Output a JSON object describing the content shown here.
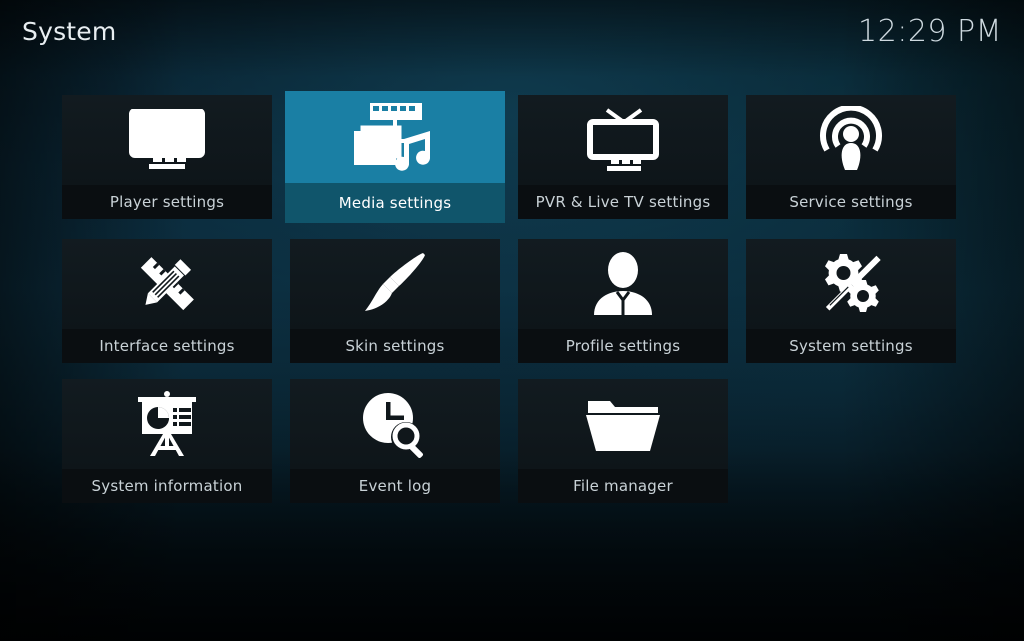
{
  "header": {
    "title": "System",
    "clock": "12:29 PM"
  },
  "colors": {
    "accent": "#1a7fa4",
    "accent_label": "#10556b",
    "tile_bg": "#10171b",
    "tile_label_bg": "#0a0e11",
    "text": "#c9d2d7",
    "icon": "#ffffff",
    "background_top": "#0c2d3f",
    "background_bottom": "#01070b"
  },
  "grid": {
    "rows": [
      [
        {
          "id": "player-settings",
          "label": "Player settings",
          "icon": "monitor-play-icon",
          "selected": false
        },
        {
          "id": "media-settings",
          "label": "Media settings",
          "icon": "media-filmstrip-photo-music-icon",
          "selected": true
        },
        {
          "id": "pvr-live-tv",
          "label": "PVR & Live TV settings",
          "icon": "television-antenna-icon",
          "selected": false
        },
        {
          "id": "service-settings",
          "label": "Service settings",
          "icon": "broadcast-person-icon",
          "selected": false
        }
      ],
      [
        {
          "id": "interface-settings",
          "label": "Interface settings",
          "icon": "pencil-ruler-icon",
          "selected": false
        },
        {
          "id": "skin-settings",
          "label": "Skin settings",
          "icon": "paintbrush-icon",
          "selected": false
        },
        {
          "id": "profile-settings",
          "label": "Profile settings",
          "icon": "person-bust-icon",
          "selected": false
        },
        {
          "id": "system-settings",
          "label": "System settings",
          "icon": "gears-screwdriver-icon",
          "selected": false
        }
      ],
      [
        {
          "id": "system-information",
          "label": "System information",
          "icon": "presentation-chart-icon",
          "selected": false
        },
        {
          "id": "event-log",
          "label": "Event log",
          "icon": "clock-magnifier-icon",
          "selected": false
        },
        {
          "id": "file-manager",
          "label": "File manager",
          "icon": "folder-open-icon",
          "selected": false
        }
      ]
    ]
  }
}
